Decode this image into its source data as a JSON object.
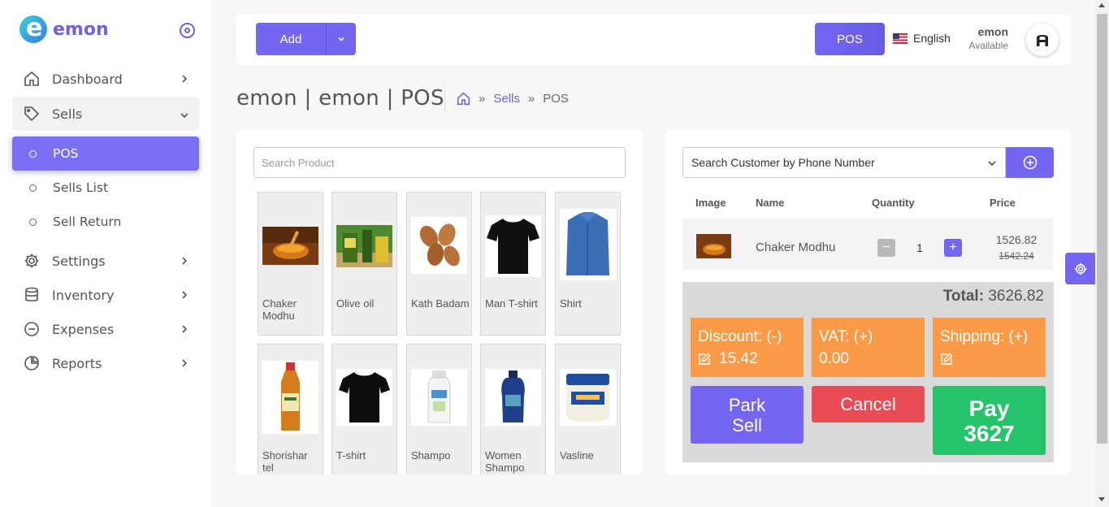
{
  "brand": {
    "name": "emon"
  },
  "sidebar": {
    "items": [
      {
        "label": "Dashboard",
        "icon": "home-icon"
      },
      {
        "label": "Sells",
        "icon": "tag-icon"
      },
      {
        "label": "Settings",
        "icon": "gear-icon"
      },
      {
        "label": "Inventory",
        "icon": "database-icon"
      },
      {
        "label": "Expenses",
        "icon": "minus-circle-icon"
      },
      {
        "label": "Reports",
        "icon": "pie-chart-icon"
      }
    ],
    "sub_items": [
      {
        "label": "POS",
        "active": true
      },
      {
        "label": "Sells List"
      },
      {
        "label": "Sell Return"
      }
    ]
  },
  "header": {
    "add_label": "Add",
    "pos_label": "POS",
    "language": "English",
    "user_name": "emon",
    "user_status": "Available"
  },
  "page": {
    "title": "emon | emon | POS",
    "breadcrumb": [
      "Sells",
      "POS"
    ]
  },
  "products": {
    "search_placeholder": "Search Product",
    "items": [
      {
        "name": "Chaker Modhu"
      },
      {
        "name": "Olive oil"
      },
      {
        "name": "Kath Badam"
      },
      {
        "name": "Man T-shirt"
      },
      {
        "name": "Shirt"
      },
      {
        "name": "Shorishar tel"
      },
      {
        "name": "T-shirt"
      },
      {
        "name": "Shampo"
      },
      {
        "name": "Women Shampo"
      },
      {
        "name": "Vasline"
      }
    ]
  },
  "cart": {
    "customer_placeholder": "Search Customer by Phone Number",
    "columns": [
      "Image",
      "Name",
      "Quantity",
      "Price"
    ],
    "rows": [
      {
        "name": "Chaker Modhu",
        "quantity": "1",
        "price": "1526.82",
        "old_price": "1542.24"
      }
    ],
    "total_label": "Total:",
    "total_value": "3626.82",
    "discount_label": "Discount: (-)",
    "discount_value": "15.42",
    "vat_label": "VAT: (+)",
    "vat_value": "0.00",
    "shipping_label": "Shipping: (+)",
    "park_label": "Park Sell",
    "cancel_label": "Cancel",
    "pay_label": "Pay 3627"
  },
  "colors": {
    "accent": "#7466f1",
    "orange": "#fd9a47",
    "danger": "#ea4c56",
    "success": "#26c46a"
  }
}
